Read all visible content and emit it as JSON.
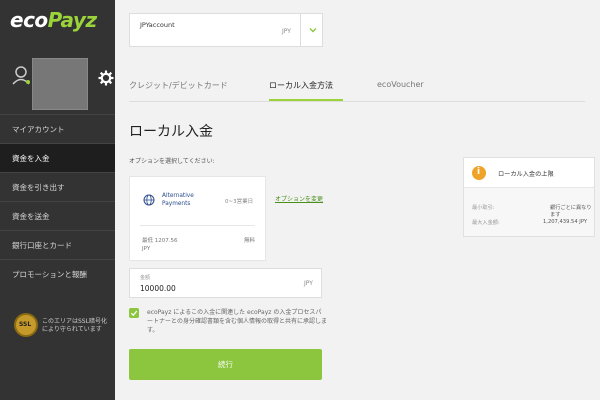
{
  "brand": {
    "logo_eco": "eco",
    "logo_payz": "Payz",
    "accent": "#8cc63f",
    "sidebar_bg": "#333333"
  },
  "sidebar": {
    "items": [
      {
        "label": "マイアカウント"
      },
      {
        "label": "資金を入金"
      },
      {
        "label": "資金を引き出す"
      },
      {
        "label": "資金を送金"
      },
      {
        "label": "銀行口座とカード"
      },
      {
        "label": "プロモーションと報酬"
      }
    ],
    "active_index": 1,
    "ssl_badge": "SSL",
    "ssl_text": "このエリアはSSL暗号化により守られています"
  },
  "account": {
    "name": "JPYaccount",
    "currency": "JPY"
  },
  "tabs": [
    {
      "label": "クレジット/デビットカード"
    },
    {
      "label": "ローカル入金方法"
    },
    {
      "label": "ecoVoucher"
    }
  ],
  "active_tab": 1,
  "section": {
    "title": "ローカル入金",
    "prompt": "オプションを選択してください:"
  },
  "method": {
    "name": "Alternative Payments",
    "processing_time": "0~3営業日",
    "min_label": "最低 1207.56",
    "fee": "無料",
    "currency": "JPY",
    "change_link": "オプションを変更"
  },
  "amount": {
    "label": "金額",
    "value": "10000.00",
    "currency": "JPY"
  },
  "consent": {
    "text": "ecoPayz によるこの入金に関連した ecoPayz の入金プロセスパートナーとの身分確認書類を含む個人情報の取得と共有に承認します。"
  },
  "continue_label": "続行",
  "limits": {
    "title": "ローカル入金の上限",
    "min_label": "最小取引:",
    "min_value": "銀行ごとに異なります",
    "max_label": "最大入金額:",
    "max_value": "1,207,439.54 JPY"
  }
}
